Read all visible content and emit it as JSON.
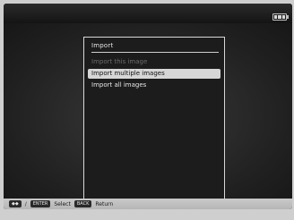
{
  "dialog": {
    "title": "Import",
    "items": [
      {
        "label": "Import this image",
        "state": "disabled"
      },
      {
        "label": "Import multiple images",
        "state": "selected"
      },
      {
        "label": "Import all images",
        "state": "normal"
      }
    ]
  },
  "footer": {
    "nav_key": "◆◆",
    "slash": "/",
    "enter_key": "ENTER",
    "select_label": "Select",
    "back_key": "BACK",
    "return_label": "Return"
  },
  "status": {
    "battery_icon": "battery-icon"
  }
}
